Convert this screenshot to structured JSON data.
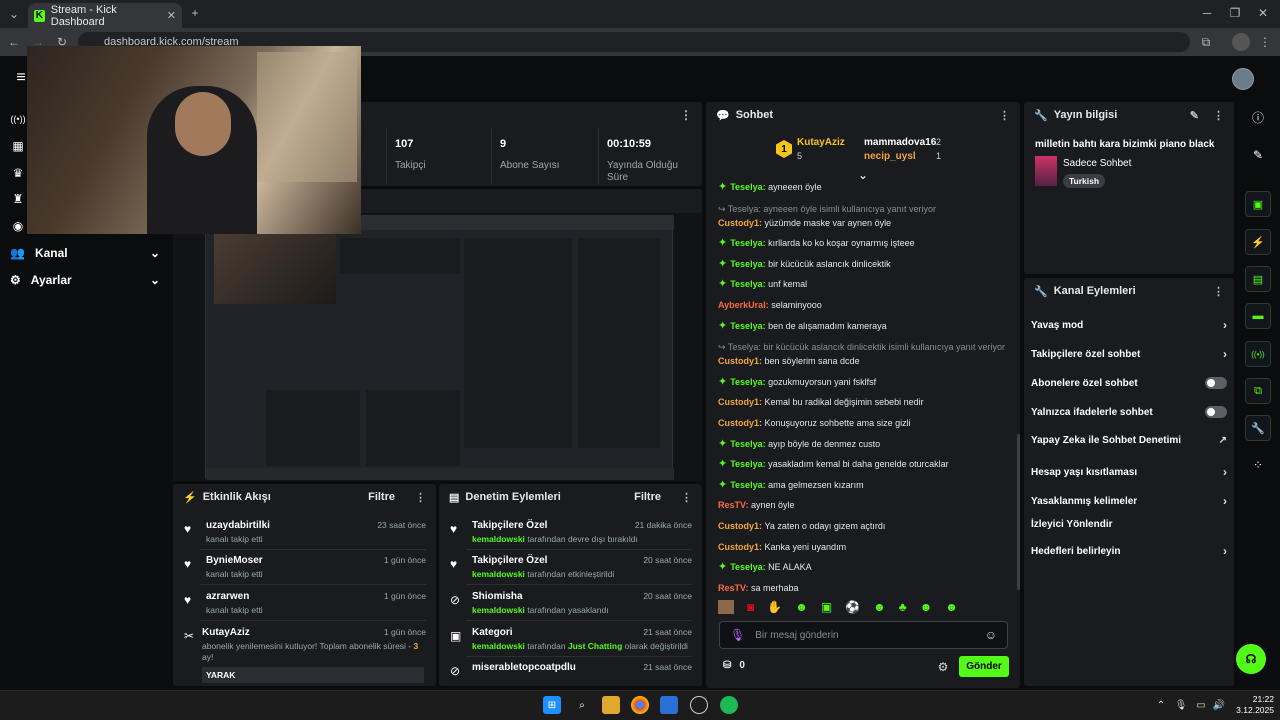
{
  "browser": {
    "tab_title": "Stream - Kick Dashboard",
    "url": "dashboard.kick.com/stream"
  },
  "sidebar": {
    "items": [
      {
        "label": "Kanal"
      },
      {
        "label": "Ayarlar"
      }
    ]
  },
  "stats": [
    {
      "value": "107",
      "label": "Takipçi"
    },
    {
      "value": "9",
      "label": "Abone Sayısı"
    },
    {
      "value": "00:10:59",
      "label": "Yayında Olduğu Süre"
    }
  ],
  "chat": {
    "title": "Sohbet",
    "top_gifters": [
      {
        "name": "KutayAziz",
        "count": "5",
        "rank": "1"
      },
      {
        "name": "mammadova16",
        "count": "2"
      },
      {
        "name": "necip_uysl",
        "count": "1"
      }
    ],
    "messages": [
      {
        "user": "Teselya",
        "text": "ayneeen öyle",
        "color": "green",
        "badge": true
      },
      {
        "reply": "Teselya: ayneeen öyle isimli kullanıcıya yanıt veriyor"
      },
      {
        "user": "Custody1",
        "text": "yüzümde maske var aynen öyle",
        "color": "orange"
      },
      {
        "user": "Teselya",
        "text": "kırllarda ko ko koşar oynarmış işteee",
        "color": "green",
        "badge": true
      },
      {
        "user": "Teselya",
        "text": "bir kücücük aslancık dinlicektik",
        "color": "green",
        "badge": true
      },
      {
        "user": "Teselya",
        "text": "unf kemal",
        "color": "green",
        "badge": true
      },
      {
        "user": "AyberkUral",
        "text": "selaminyooo",
        "color": "red"
      },
      {
        "user": "Teselya",
        "text": "ben de alışamadım kameraya",
        "color": "green",
        "badge": true
      },
      {
        "reply": "Teselya: bir kücücük aslancık dinlicektik isimli kullanıcıya yanıt veriyor"
      },
      {
        "user": "Custody1",
        "text": "ben söylerim sana dcde",
        "color": "orange"
      },
      {
        "user": "Teselya",
        "text": "gozukmuyorsun yani fsklfsf",
        "color": "green",
        "badge": true
      },
      {
        "user": "Custody1",
        "text": "Kemal bu radikal değişimin sebebi nedir",
        "color": "orange"
      },
      {
        "user": "Custody1",
        "text": "Konuşuyoruz sohbette ama size gizli",
        "color": "orange"
      },
      {
        "user": "Teselya",
        "text": "ayıp böyle de denmez custo",
        "color": "green",
        "badge": true
      },
      {
        "user": "Teselya",
        "text": "yasakladım kemal bi daha genelde oturcaklar",
        "color": "green",
        "badge": true
      },
      {
        "user": "Teselya",
        "text": "ama gelmezsen kızarım",
        "color": "green",
        "badge": true
      },
      {
        "user": "ResTV",
        "text": "aynen öyle",
        "color": "red"
      },
      {
        "user": "Custody1",
        "text": "Ya zaten o odayı gizem açtırdı",
        "color": "orange"
      },
      {
        "user": "Custody1",
        "text": "Kanka yeni uyandım",
        "color": "orange"
      },
      {
        "user": "Teselya",
        "text": "NE ALAKA",
        "color": "green",
        "badge": true
      },
      {
        "user": "ResTV",
        "text": "sa merhaba",
        "color": "red"
      }
    ],
    "input_placeholder": "Bir mesaj gönderin",
    "points": "0",
    "send_label": "Gönder"
  },
  "stream_info": {
    "title": "Yayın bilgisi",
    "stream_title": "milletin bahtı kara bizimki piano black",
    "category": "Sadece Sohbet",
    "tag": "Turkish"
  },
  "channel_actions": {
    "title": "Kanal Eylemleri",
    "items": [
      {
        "label": "Yavaş mod",
        "control": "chevron"
      },
      {
        "label": "Takipçilere özel sohbet",
        "control": "chevron"
      },
      {
        "label": "Abonelere özel sohbet",
        "control": "toggle"
      },
      {
        "label": "Yalnızca ifadelerle sohbet",
        "control": "toggle"
      },
      {
        "label": "Yapay Zeka ile Sohbet Denetimi",
        "control": "external"
      },
      {
        "label": "Hesap yaşı kısıtlaması",
        "control": "chevron"
      },
      {
        "label": "Yasaklanmış kelimeler",
        "control": "chevron"
      },
      {
        "label": "İzleyici Yönlendir",
        "control": "none"
      },
      {
        "label": "Hedefleri belirleyin",
        "control": "chevron"
      }
    ]
  },
  "activity": {
    "title": "Etkinlik Akışı",
    "filter": "Filtre",
    "items": [
      {
        "name": "uzaydabirtilki",
        "sub": "kanalı takip etti",
        "time": "23 saat önce"
      },
      {
        "name": "BynieMoser",
        "sub": "kanalı takip etti",
        "time": "1 gün önce"
      },
      {
        "name": "azrarwen",
        "sub": "kanalı takip etti",
        "time": "1 gün önce"
      },
      {
        "name": "KutayAziz",
        "sub": "abonelik yenilemesini kutluyor! Toplam abonelik süresi - ",
        "months": "3",
        "sub2": "ay!",
        "time": "1 gün önce",
        "note": "YARAK"
      }
    ]
  },
  "moderation": {
    "title": "Denetim Eylemleri",
    "filter": "Filtre",
    "items": [
      {
        "name": "Takipçilere Özel",
        "mod": "kemaldowski",
        "sub": "tarafından devre dışı bırakıldı",
        "time": "21 dakika önce"
      },
      {
        "name": "Takipçilere Özel",
        "mod": "kemaldowski",
        "sub": "tarafından etkinleştirildi",
        "time": "20 saat önce"
      },
      {
        "name": "Shiomisha",
        "mod": "kemaldowski",
        "sub": "tarafından yasaklandı",
        "time": "20 saat önce"
      },
      {
        "name": "Kategori",
        "mod": "kemaldowski",
        "sub": "tarafından",
        "cat": "Just Chatting",
        "sub2": "olarak değiştirildi",
        "time": "21 saat önce"
      },
      {
        "name": "miserabletopcoatpdlu",
        "time": "21 saat önce"
      }
    ]
  },
  "taskbar": {
    "time": "21:22",
    "date": "3.12.2025"
  }
}
